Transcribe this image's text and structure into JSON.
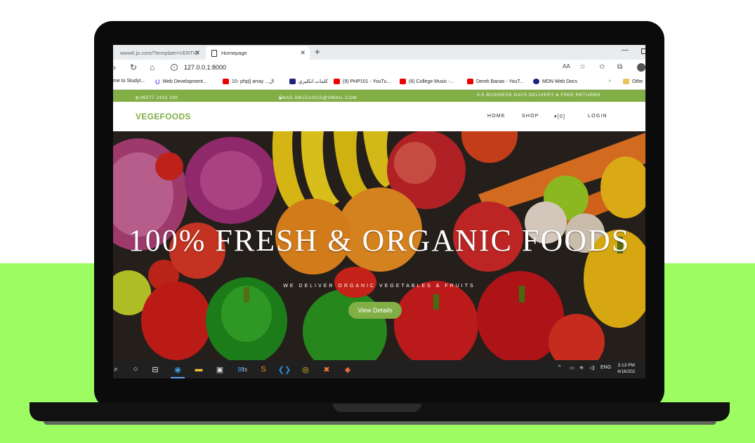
{
  "colors": {
    "band": "#9dfc61",
    "site_green": "#82ae46",
    "laptop": "#0b0b0b"
  },
  "browser": {
    "tabs": [
      {
        "label": "www6.jo.com/?template=VERTIC",
        "active": false
      },
      {
        "label": "Homepage",
        "active": true
      }
    ],
    "new_tab": "+",
    "url": "127.0.0.1:8000",
    "bookmarks": [
      {
        "label": "me to Studyt...",
        "icon": "none"
      },
      {
        "label": "Web Development...",
        "icon": "udemy-icon"
      },
      {
        "label": "10- php|| array ...ال",
        "icon": "youtube-icon"
      },
      {
        "label": "كلمات انكليزي",
        "icon": "k-icon"
      },
      {
        "label": "(9) PHP101 - YouTu...",
        "icon": "youtube-icon"
      },
      {
        "label": "(6) College Music -...",
        "icon": "youtube-icon"
      },
      {
        "label": "Derek Banas - YouT...",
        "icon": "youtube-icon"
      },
      {
        "label": "MDN Web Docs",
        "icon": "mdn-icon"
      },
      {
        "label": "Othe",
        "icon": "folder-icon"
      }
    ]
  },
  "site": {
    "topbar": {
      "phone": "+ 96277 2432 330",
      "email": "ENAD.ABUZAID15@GMAIL.COM",
      "delivery": "3-5 BUSINESS DAYS DELIVERY & FREE RETURNS"
    },
    "brand": "VEGEFOODS",
    "nav": [
      "HOME",
      "SHOP",
      "[0]",
      "LOGIN"
    ],
    "hero": {
      "title": "100% Fresh & Organic Foods",
      "subtitle": "WE DELIVER ORGANIC VEGETABLES & FRUITS",
      "button": "View Details"
    }
  },
  "taskbar": {
    "tray_lang": "ENG",
    "time": "3:13 PM",
    "date": "4/16/202",
    "badge": "73"
  }
}
